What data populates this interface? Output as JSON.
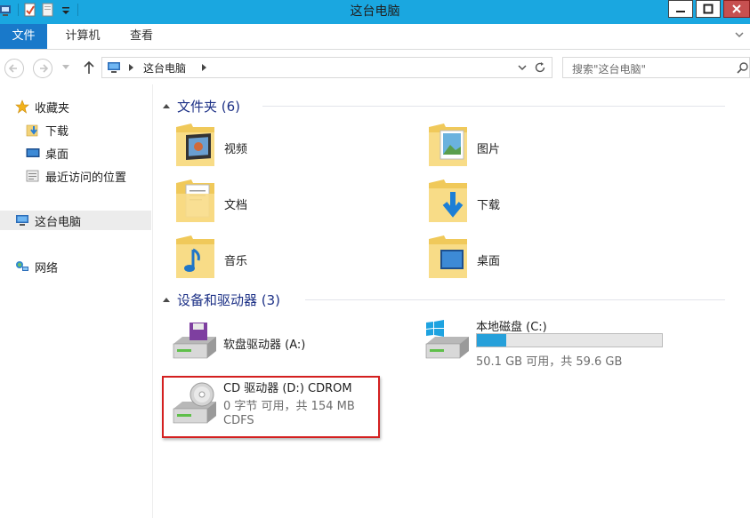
{
  "window": {
    "title": "这台电脑"
  },
  "ribbon": {
    "tabs": [
      {
        "label": "文件"
      },
      {
        "label": "计算机"
      },
      {
        "label": "查看"
      }
    ]
  },
  "address": {
    "path_label": "这台电脑",
    "search_placeholder": "搜索\"这台电脑\""
  },
  "navpane": {
    "favorites_label": "收藏夹",
    "downloads_label": "下载",
    "desktop_label": "桌面",
    "recent_label": "最近访问的位置",
    "this_pc_label": "这台电脑",
    "network_label": "网络"
  },
  "content": {
    "folders_header": "文件夹 (6)",
    "folders": [
      {
        "name": "视频",
        "icon": "videos-folder-icon"
      },
      {
        "name": "图片",
        "icon": "pictures-folder-icon"
      },
      {
        "name": "文档",
        "icon": "documents-folder-icon"
      },
      {
        "name": "下载",
        "icon": "downloads-folder-icon"
      },
      {
        "name": "音乐",
        "icon": "music-folder-icon"
      },
      {
        "name": "桌面",
        "icon": "desktop-folder-icon"
      }
    ],
    "devices_header": "设备和驱动器 (3)",
    "floppy": {
      "name": "软盘驱动器 (A:)"
    },
    "local_disk": {
      "name": "本地磁盘 (C:)",
      "space": "50.1 GB 可用，共 59.6 GB",
      "used_fraction": 0.16
    },
    "cd_drive": {
      "name": "CD 驱动器 (D:) CDROM",
      "space": "0 字节 可用，共 154 MB",
      "fs": "CDFS"
    }
  },
  "colors": {
    "titlebar": "#1aa7e0",
    "file_tab": "#1979ca",
    "group_header_text": "#1e3287",
    "usage_bar": "#26a0da",
    "highlight_border": "#d42020"
  }
}
